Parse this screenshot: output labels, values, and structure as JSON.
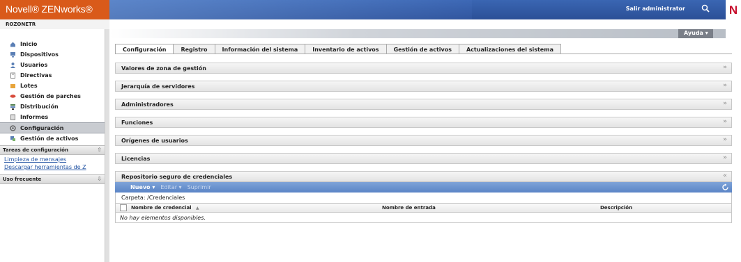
{
  "header": {
    "brand": "Novell® ZENworks®",
    "logout": "Salir administrator",
    "zone": "ROZONETR",
    "help": "Ayuda ▾",
    "novell_mark": "N"
  },
  "sidebar": {
    "nav": [
      {
        "label": "Inicio",
        "icon": "home-icon"
      },
      {
        "label": "Dispositivos",
        "icon": "device-icon"
      },
      {
        "label": "Usuarios",
        "icon": "users-icon"
      },
      {
        "label": "Directivas",
        "icon": "policy-icon"
      },
      {
        "label": "Lotes",
        "icon": "bundle-icon"
      },
      {
        "label": "Gestión de parches",
        "icon": "patch-icon"
      },
      {
        "label": "Distribución",
        "icon": "deployment-icon"
      },
      {
        "label": "Informes",
        "icon": "reports-icon"
      },
      {
        "label": "Configuración",
        "icon": "configuration-icon"
      },
      {
        "label": "Gestión de activos",
        "icon": "asset-icon"
      }
    ],
    "config_tasks": {
      "title": "Tareas de configuración",
      "links": [
        "Limpieza de mensajes",
        "Descargar herramientas de Z"
      ]
    },
    "frequent": {
      "title": "Uso frecuente"
    }
  },
  "tabs": [
    "Configuración",
    "Registro",
    "Información del sistema",
    "Inventario de activos",
    "Gestión de activos",
    "Actualizaciones del sistema"
  ],
  "sections": [
    "Valores de zona de gestión",
    "Jerarquía de servidores",
    "Administradores",
    "Funciones",
    "Orígenes de usuarios",
    "Licencias",
    "Repositorio seguro de credenciales"
  ],
  "credentials": {
    "toolbar": {
      "new": "Nuevo ▾",
      "edit": "Editar ▾",
      "delete": "Suprimir"
    },
    "folder_label": "Carpeta:",
    "folder_value": "/Credenciales",
    "columns": [
      "Nombre de credencial",
      "Nombre de entrada",
      "Descripción"
    ],
    "sort_indicator": "▲",
    "empty": "No hay elementos disponibles."
  },
  "colors": {
    "brand_orange": "#d95a1a",
    "header_blue": "#2b4f97",
    "toolbar_blue": "#5a84c6",
    "link_blue": "#2455a4"
  }
}
